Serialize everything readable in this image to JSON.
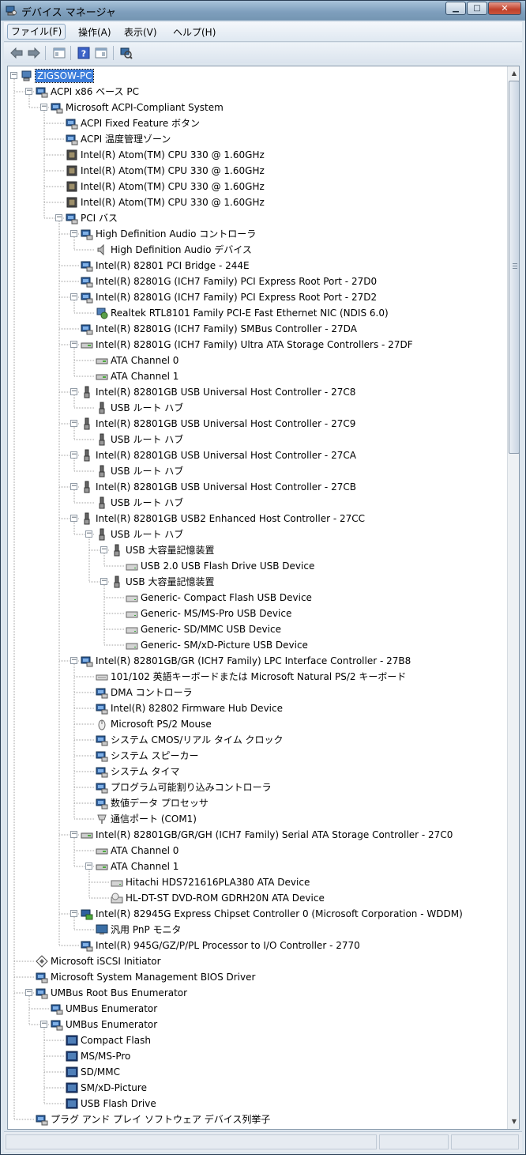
{
  "window": {
    "title": "デバイス マネージャ",
    "controls": {
      "minimize": "▁",
      "maximize": "□",
      "close": "✕"
    }
  },
  "menu": [
    {
      "label": "ファイル(F)",
      "active": true
    },
    {
      "label": "操作(A)",
      "active": false
    },
    {
      "label": "表示(V)",
      "active": false
    },
    {
      "label": "ヘルプ(H)",
      "active": false
    }
  ],
  "toolbar": [
    {
      "name": "back-button",
      "icon": "arrow-left-icon"
    },
    {
      "name": "forward-button",
      "icon": "arrow-right-icon"
    },
    {
      "name": "up-button",
      "icon": "properties-icon"
    },
    {
      "name": "help-button",
      "icon": "help-icon"
    },
    {
      "name": "view-button",
      "icon": "view-icon"
    },
    {
      "name": "scan-button",
      "icon": "scan-hardware-icon"
    }
  ],
  "colors": {
    "selection": "#3b7ddb",
    "titlebar": "#7f9fbd",
    "close": "#c0402a"
  },
  "tree": [
    {
      "d": 0,
      "e": "-",
      "icon": "computer-icon",
      "label": "ZIGSOW-PC",
      "selected": true
    },
    {
      "d": 1,
      "e": "-",
      "icon": "device-icon",
      "label": "ACPI x86 ベース PC"
    },
    {
      "d": 2,
      "e": "-",
      "icon": "device-icon",
      "label": "Microsoft ACPI-Compliant System"
    },
    {
      "d": 3,
      "e": "",
      "icon": "device-icon",
      "label": "ACPI Fixed Feature ボタン"
    },
    {
      "d": 3,
      "e": "",
      "icon": "device-icon",
      "label": "ACPI 温度管理ゾーン"
    },
    {
      "d": 3,
      "e": "",
      "icon": "cpu-icon",
      "label": "Intel(R) Atom(TM) CPU  330   @ 1.60GHz"
    },
    {
      "d": 3,
      "e": "",
      "icon": "cpu-icon",
      "label": "Intel(R) Atom(TM) CPU  330   @ 1.60GHz"
    },
    {
      "d": 3,
      "e": "",
      "icon": "cpu-icon",
      "label": "Intel(R) Atom(TM) CPU  330   @ 1.60GHz"
    },
    {
      "d": 3,
      "e": "",
      "icon": "cpu-icon",
      "label": "Intel(R) Atom(TM) CPU  330   @ 1.60GHz"
    },
    {
      "d": 3,
      "e": "-",
      "icon": "device-icon",
      "label": "PCI バス"
    },
    {
      "d": 4,
      "e": "-",
      "icon": "device-icon",
      "label": "High Definition Audio コントローラ"
    },
    {
      "d": 5,
      "e": "",
      "icon": "speaker-icon",
      "label": "High Definition Audio デバイス"
    },
    {
      "d": 4,
      "e": "",
      "icon": "device-icon",
      "label": "Intel(R) 82801 PCI Bridge - 244E"
    },
    {
      "d": 4,
      "e": "",
      "icon": "device-icon",
      "label": "Intel(R) 82801G (ICH7 Family) PCI Express Root Port - 27D0"
    },
    {
      "d": 4,
      "e": "-",
      "icon": "device-icon",
      "label": "Intel(R) 82801G (ICH7 Family) PCI Express Root Port - 27D2"
    },
    {
      "d": 5,
      "e": "",
      "icon": "network-icon",
      "label": "Realtek RTL8101 Family PCI-E Fast Ethernet NIC (NDIS 6.0)"
    },
    {
      "d": 4,
      "e": "",
      "icon": "device-icon",
      "label": "Intel(R) 82801G (ICH7 Family) SMBus Controller - 27DA"
    },
    {
      "d": 4,
      "e": "-",
      "icon": "ide-icon",
      "label": "Intel(R) 82801G (ICH7 Family) Ultra ATA Storage Controllers - 27DF"
    },
    {
      "d": 5,
      "e": "",
      "icon": "ide-icon",
      "label": "ATA Channel 0"
    },
    {
      "d": 5,
      "e": "",
      "icon": "ide-icon",
      "label": "ATA Channel 1"
    },
    {
      "d": 4,
      "e": "-",
      "icon": "usb-icon",
      "label": "Intel(R) 82801GB USB Universal Host Controller - 27C8"
    },
    {
      "d": 5,
      "e": "",
      "icon": "usb-icon",
      "label": "USB ルート ハブ"
    },
    {
      "d": 4,
      "e": "-",
      "icon": "usb-icon",
      "label": "Intel(R) 82801GB USB Universal Host Controller - 27C9"
    },
    {
      "d": 5,
      "e": "",
      "icon": "usb-icon",
      "label": "USB ルート ハブ"
    },
    {
      "d": 4,
      "e": "-",
      "icon": "usb-icon",
      "label": "Intel(R) 82801GB USB Universal Host Controller - 27CA"
    },
    {
      "d": 5,
      "e": "",
      "icon": "usb-icon",
      "label": "USB ルート ハブ"
    },
    {
      "d": 4,
      "e": "-",
      "icon": "usb-icon",
      "label": "Intel(R) 82801GB USB Universal Host Controller - 27CB"
    },
    {
      "d": 5,
      "e": "",
      "icon": "usb-icon",
      "label": "USB ルート ハブ"
    },
    {
      "d": 4,
      "e": "-",
      "icon": "usb-icon",
      "label": "Intel(R) 82801GB USB2 Enhanced Host Controller - 27CC"
    },
    {
      "d": 5,
      "e": "-",
      "icon": "usb-icon",
      "label": "USB ルート ハブ"
    },
    {
      "d": 6,
      "e": "-",
      "icon": "usb-icon",
      "label": "USB 大容量記憶装置"
    },
    {
      "d": 7,
      "e": "",
      "icon": "drive-icon",
      "label": "USB 2.0 USB Flash Drive USB Device"
    },
    {
      "d": 6,
      "e": "-",
      "icon": "usb-icon",
      "label": "USB 大容量記憶装置"
    },
    {
      "d": 7,
      "e": "",
      "icon": "drive-icon",
      "label": "Generic- Compact Flash USB Device"
    },
    {
      "d": 7,
      "e": "",
      "icon": "drive-icon",
      "label": "Generic- MS/MS-Pro USB Device"
    },
    {
      "d": 7,
      "e": "",
      "icon": "drive-icon",
      "label": "Generic- SD/MMC USB Device"
    },
    {
      "d": 7,
      "e": "",
      "icon": "drive-icon",
      "label": "Generic- SM/xD-Picture USB Device"
    },
    {
      "d": 4,
      "e": "-",
      "icon": "device-icon",
      "label": "Intel(R) 82801GB/GR (ICH7 Family) LPC Interface Controller - 27B8"
    },
    {
      "d": 5,
      "e": "",
      "icon": "keyboard-icon",
      "label": "101/102 英語キーボードまたは Microsoft Natural PS/2 キーボード"
    },
    {
      "d": 5,
      "e": "",
      "icon": "device-icon",
      "label": "DMA コントローラ"
    },
    {
      "d": 5,
      "e": "",
      "icon": "device-icon",
      "label": "Intel(R) 82802 Firmware Hub Device"
    },
    {
      "d": 5,
      "e": "",
      "icon": "mouse-icon",
      "label": "Microsoft PS/2 Mouse"
    },
    {
      "d": 5,
      "e": "",
      "icon": "device-icon",
      "label": "システム CMOS/リアル タイム クロック"
    },
    {
      "d": 5,
      "e": "",
      "icon": "device-icon",
      "label": "システム スピーカー"
    },
    {
      "d": 5,
      "e": "",
      "icon": "device-icon",
      "label": "システム タイマ"
    },
    {
      "d": 5,
      "e": "",
      "icon": "device-icon",
      "label": "プログラム可能割り込みコントローラ"
    },
    {
      "d": 5,
      "e": "",
      "icon": "device-icon",
      "label": "数値データ プロセッサ"
    },
    {
      "d": 5,
      "e": "",
      "icon": "port-icon",
      "label": "通信ポート (COM1)"
    },
    {
      "d": 4,
      "e": "-",
      "icon": "ide-icon",
      "label": "Intel(R) 82801GB/GR/GH (ICH7 Family) Serial ATA Storage Controller - 27C0"
    },
    {
      "d": 5,
      "e": "",
      "icon": "ide-icon",
      "label": "ATA Channel 0"
    },
    {
      "d": 5,
      "e": "-",
      "icon": "ide-icon",
      "label": "ATA Channel 1"
    },
    {
      "d": 6,
      "e": "",
      "icon": "drive-icon",
      "label": "Hitachi HDS721616PLA380 ATA Device"
    },
    {
      "d": 6,
      "e": "",
      "icon": "dvd-icon",
      "label": "HL-DT-ST DVD-ROM GDRH20N ATA Device"
    },
    {
      "d": 4,
      "e": "-",
      "icon": "display-icon",
      "label": "Intel(R) 82945G Express Chipset Controller 0 (Microsoft Corporation - WDDM)"
    },
    {
      "d": 5,
      "e": "",
      "icon": "monitor-icon",
      "label": "汎用 PnP モニタ"
    },
    {
      "d": 4,
      "e": "",
      "icon": "device-icon",
      "label": "Intel(R) 945G/GZ/P/PL Processor to I/O Controller - 2770"
    },
    {
      "d": 1,
      "e": "",
      "icon": "iscsi-icon",
      "label": "Microsoft iSCSI Initiator"
    },
    {
      "d": 1,
      "e": "",
      "icon": "device-icon",
      "label": "Microsoft System Management BIOS Driver"
    },
    {
      "d": 1,
      "e": "-",
      "icon": "device-icon",
      "label": "UMBus Root Bus Enumerator"
    },
    {
      "d": 2,
      "e": "",
      "icon": "device-icon",
      "label": "UMBus Enumerator"
    },
    {
      "d": 2,
      "e": "-",
      "icon": "device-icon",
      "label": "UMBus Enumerator"
    },
    {
      "d": 3,
      "e": "",
      "icon": "card-icon",
      "label": "Compact Flash"
    },
    {
      "d": 3,
      "e": "",
      "icon": "card-icon",
      "label": "MS/MS-Pro"
    },
    {
      "d": 3,
      "e": "",
      "icon": "card-icon",
      "label": "SD/MMC"
    },
    {
      "d": 3,
      "e": "",
      "icon": "card-icon",
      "label": "SM/xD-Picture"
    },
    {
      "d": 3,
      "e": "",
      "icon": "card-icon",
      "label": "USB Flash Drive"
    },
    {
      "d": 1,
      "e": "",
      "icon": "device-icon",
      "label": "プラグ アンド プレイ ソフトウェア デバイス列挙子"
    }
  ]
}
